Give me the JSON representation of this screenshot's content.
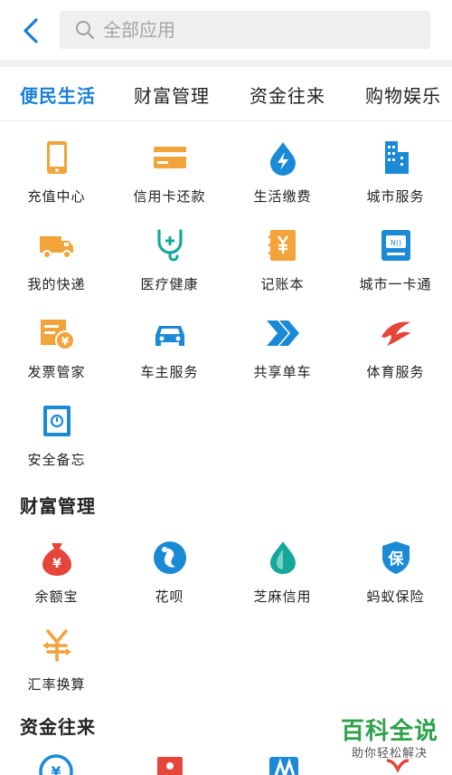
{
  "header": {
    "search_placeholder": "全部应用"
  },
  "tabs": [
    {
      "label": "便民生活",
      "active": true
    },
    {
      "label": "财富管理",
      "active": false
    },
    {
      "label": "资金往来",
      "active": false
    },
    {
      "label": "购物娱乐",
      "active": false
    }
  ],
  "sections": {
    "convenience": {
      "items": [
        {
          "label": "充值中心",
          "icon": "phone-icon"
        },
        {
          "label": "信用卡还款",
          "icon": "credit-card-icon"
        },
        {
          "label": "生活缴费",
          "icon": "water-drop-icon"
        },
        {
          "label": "城市服务",
          "icon": "city-buildings-icon"
        },
        {
          "label": "我的快递",
          "icon": "delivery-truck-icon"
        },
        {
          "label": "医疗健康",
          "icon": "stethoscope-icon"
        },
        {
          "label": "记账本",
          "icon": "ledger-icon"
        },
        {
          "label": "城市一卡通",
          "icon": "transit-card-icon"
        },
        {
          "label": "发票管家",
          "icon": "invoice-icon"
        },
        {
          "label": "车主服务",
          "icon": "car-icon"
        },
        {
          "label": "共享单车",
          "icon": "bike-share-icon"
        },
        {
          "label": "体育服务",
          "icon": "sports-icon"
        },
        {
          "label": "安全备忘",
          "icon": "safe-memo-icon"
        }
      ]
    },
    "wealth": {
      "title": "财富管理",
      "items": [
        {
          "label": "余额宝",
          "icon": "yuebao-icon"
        },
        {
          "label": "花呗",
          "icon": "huabei-icon"
        },
        {
          "label": "芝麻信用",
          "icon": "sesame-credit-icon"
        },
        {
          "label": "蚂蚁保险",
          "icon": "insurance-shield-icon"
        },
        {
          "label": "汇率换算",
          "icon": "exchange-rate-icon"
        }
      ]
    },
    "transfers": {
      "title": "资金往来"
    }
  },
  "watermark": {
    "title": "百科全说",
    "subtitle": "助你轻松解决"
  },
  "colors": {
    "accent": "#1b7fd6",
    "orange": "#f2a33a",
    "blue": "#1a8ad6",
    "red": "#e6453c",
    "teal": "#14a89a"
  }
}
